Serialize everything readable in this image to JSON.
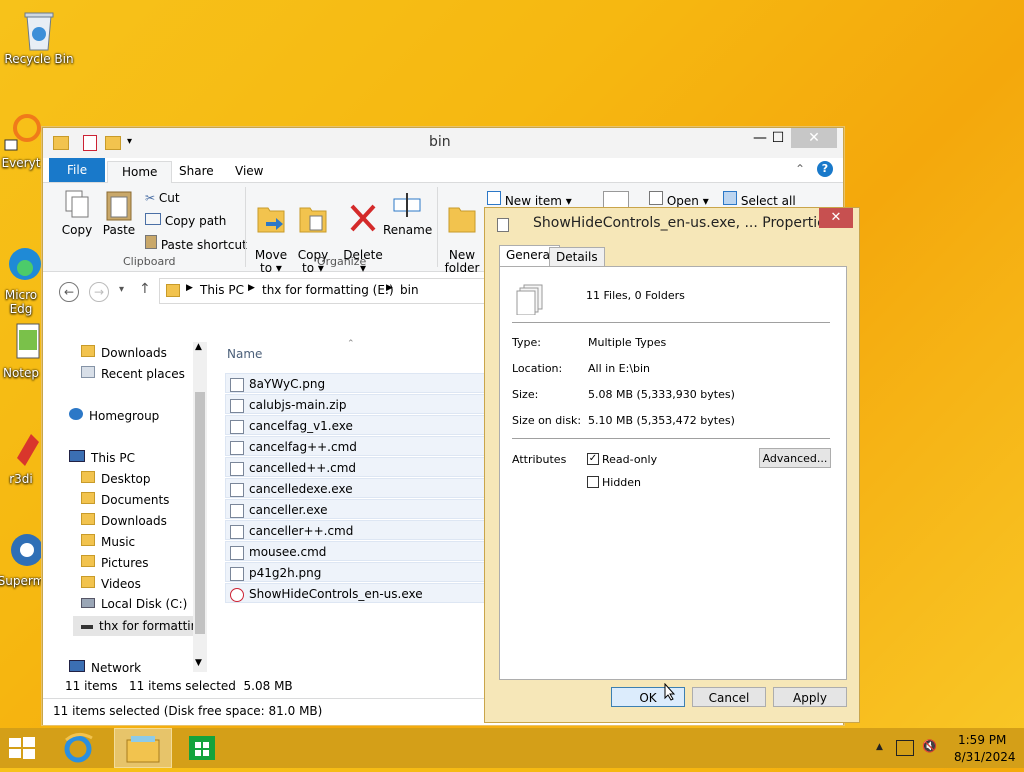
{
  "desktop": {
    "icons": [
      {
        "label": "Recycle Bin"
      },
      {
        "label": "Everyt"
      },
      {
        "label": "Micro\nEdg"
      },
      {
        "label": "Notep"
      },
      {
        "label": "r3di"
      },
      {
        "label": "Superm"
      }
    ]
  },
  "explorer": {
    "title": "bin",
    "tabs": [
      "File",
      "Home",
      "Share",
      "View"
    ],
    "ribbon": {
      "copy": "Copy",
      "paste": "Paste",
      "cut": "Cut",
      "copy_path": "Copy path",
      "paste_shortcut": "Paste shortcut",
      "clipboard": "Clipboard",
      "move_to": "Move\nto ▾",
      "copy_to": "Copy\nto ▾",
      "delete": "Delete\n▾",
      "rename": "Rename",
      "organize": "Organize",
      "new_folder": "New\nfolder",
      "new_item": "New item ▾",
      "open": "Open ▾",
      "select_all": "Select all"
    },
    "address": {
      "parts": [
        "This PC",
        "thx for formatting (E:)",
        "bin"
      ]
    },
    "column_name": "Name",
    "nav": [
      "Downloads",
      "Recent places",
      "Homegroup",
      "This PC",
      "Desktop",
      "Documents",
      "Downloads",
      "Music",
      "Pictures",
      "Videos",
      "Local Disk (C:)",
      "thx for formatting",
      "Network"
    ],
    "files": [
      "8aYWyC.png",
      "calubjs-main.zip",
      "cancelfag_v1.exe",
      "cancelfag++.cmd",
      "cancelled++.cmd",
      "cancelledexe.exe",
      "canceller.exe",
      "canceller++.cmd",
      "mousee.cmd",
      "p41g2h.png",
      "ShowHideControls_en-us.exe"
    ],
    "status_items": "11 items",
    "status_selected": "11 items selected  5.08 MB",
    "status_bottom": "11 items selected (Disk free space: 81.0 MB)"
  },
  "dialog": {
    "title": "ShowHideControls_en-us.exe, ... Properties",
    "tab_general": "General",
    "tab_details": "Details",
    "summary": "11 Files, 0 Folders",
    "type_label": "Type:",
    "type_value": "Multiple Types",
    "location_label": "Location:",
    "location_value": "All in E:\\bin",
    "size_label": "Size:",
    "size_value": "5.08 MB (5,333,930 bytes)",
    "size_disk_label": "Size on disk:",
    "size_disk_value": "5.10 MB (5,353,472 bytes)",
    "attributes_label": "Attributes",
    "readonly_label": "Read-only",
    "hidden_label": "Hidden",
    "advanced": "Advanced...",
    "ok": "OK",
    "cancel": "Cancel",
    "apply": "Apply",
    "readonly_checked": true,
    "hidden_checked": false
  },
  "taskbar": {
    "time": "1:59 PM",
    "date": "8/31/2024"
  },
  "colors": {
    "accent": "#1979ca",
    "close": "#c75050"
  }
}
